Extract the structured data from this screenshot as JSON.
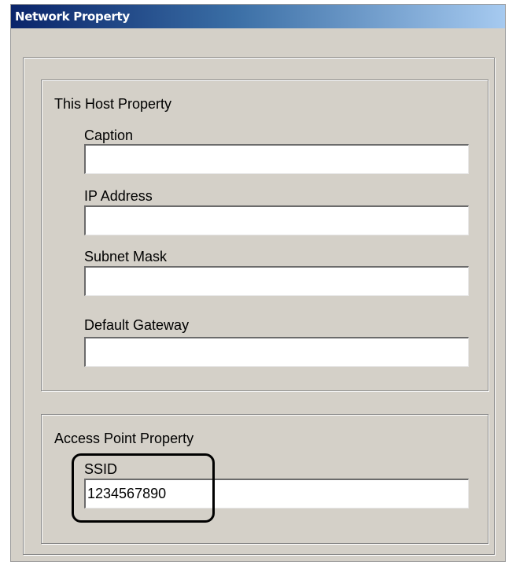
{
  "window": {
    "title": "Network Property"
  },
  "host_property": {
    "group_label": "This Host Property",
    "caption": {
      "label": "Caption",
      "value": ""
    },
    "ip_address": {
      "label": "IP Address",
      "value": ""
    },
    "subnet_mask": {
      "label": "Subnet Mask",
      "value": ""
    },
    "default_gateway": {
      "label": "Default Gateway",
      "value": ""
    }
  },
  "access_point": {
    "group_label": "Access Point Property",
    "ssid": {
      "label": "SSID",
      "value": "1234567890"
    }
  },
  "colors": {
    "dialog_bg": "#d4d0c8",
    "title_bar_start": "#0a246a",
    "title_bar_end": "#a6caf0",
    "highlight_border": "#000000"
  }
}
